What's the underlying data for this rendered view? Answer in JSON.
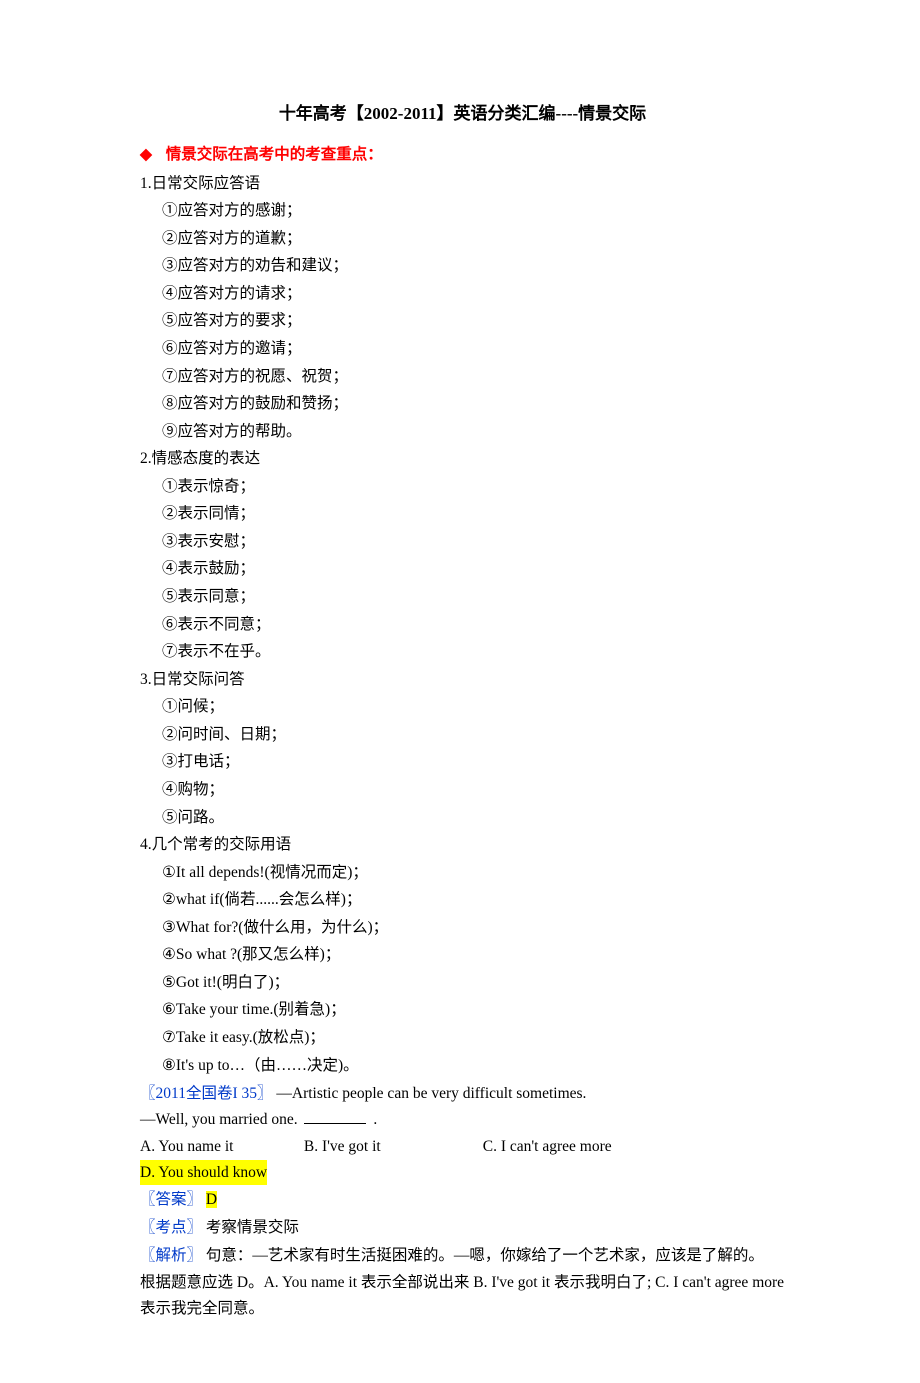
{
  "title": "十年高考【2002-2011】英语分类汇编----情景交际",
  "section_head": "情景交际在高考中的考查重点：",
  "outline": {
    "g1": {
      "head": "1.日常交际应答语",
      "items": [
        "①应答对方的感谢；",
        "②应答对方的道歉；",
        "③应答对方的劝告和建议；",
        "④应答对方的请求；",
        "⑤应答对方的要求；",
        "⑥应答对方的邀请；",
        "⑦应答对方的祝愿、祝贺；",
        "⑧应答对方的鼓励和赞扬；",
        "⑨应答对方的帮助。"
      ]
    },
    "g2": {
      "head": "2.情感态度的表达",
      "items": [
        "①表示惊奇；",
        "②表示同情；",
        "③表示安慰；",
        "④表示鼓励；",
        "⑤表示同意；",
        "⑥表示不同意；",
        "⑦表示不在乎。"
      ]
    },
    "g3": {
      "head": "3.日常交际问答",
      "items": [
        "①问候；",
        "②问时间、日期；",
        "③打电话；",
        "④购物；",
        "⑤问路。"
      ]
    },
    "g4": {
      "head": "4.几个常考的交际用语",
      "items": [
        "①It all depends!(视情况而定)；",
        "②what if(倘若......会怎么样)；",
        "③What for?(做什么用，为什么)；",
        "④So what ?(那又怎么样)；",
        "⑤Got it!(明白了)；",
        "⑥Take your time.(别着急)；",
        "⑦Take it easy.(放松点)；",
        "⑧It's up to…（由……决定)。"
      ]
    }
  },
  "question": {
    "ref_open": "〖",
    "ref_close": "〗",
    "ref_text": "2011全国卷I 35",
    "line1_after": "—Artistic people can be very difficult sometimes.",
    "line2": "—Well, you married one.",
    "period": ".",
    "choices": {
      "a": "A. You name it",
      "b": "B. I've got it",
      "c": "C. I can't agree more",
      "d": "D. You should know"
    },
    "answer_label": "〖答案〗",
    "answer_value": "D",
    "exam_point_label": "〖考点〗",
    "exam_point_value": "考察情景交际",
    "analysis_label": "〖解析〗",
    "analysis_text1": "句意：—艺术家有时生活挺困难的。—嗯，你嫁给了一个艺术家，应该是了解的。",
    "analysis_text2": "根据题意应选 D。A. You name it 表示全部说出来  B. I've got it 表示我明白了; C. I can't agree more 表示我完全同意。"
  }
}
